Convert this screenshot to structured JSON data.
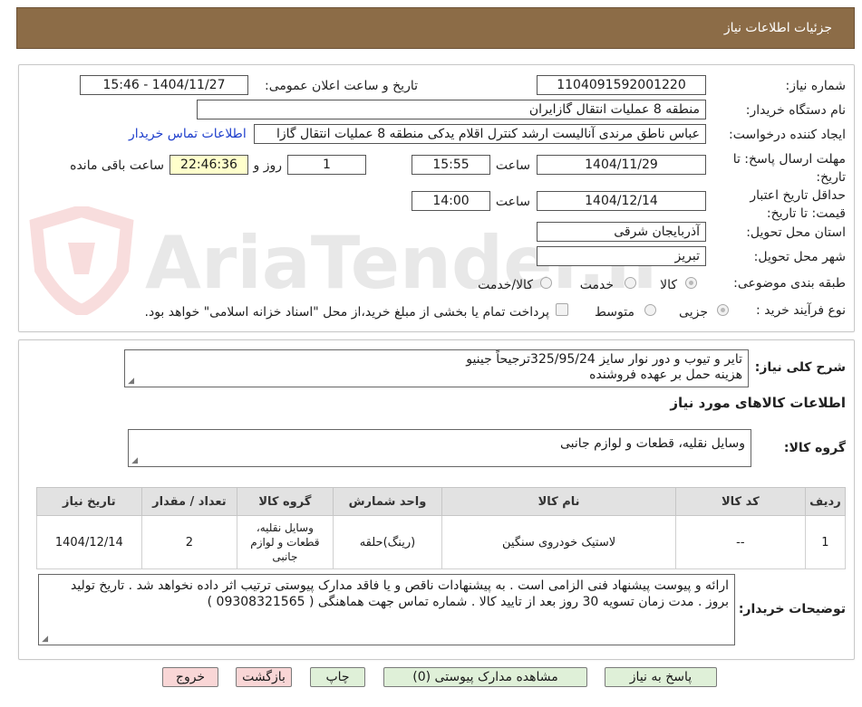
{
  "header": {
    "title": "جزئیات اطلاعات نیاز"
  },
  "watermark": {
    "text": "AriaTender.neT"
  },
  "form": {
    "need_number_label": "شماره نیاز:",
    "need_number": "1104091592001220",
    "announce_label": "تاریخ و ساعت اعلان عمومی:",
    "announce_value": "1404/11/27 - 15:46",
    "buyer_label": "نام دستگاه خریدار:",
    "buyer_value": "منطقه 8 عملیات انتقال گازایران",
    "creator_label": "ایجاد کننده درخواست:",
    "creator_value": "عباس ناطق مرندی آنالیست ارشد کنترل اقلام یدکی منطقه 8 عملیات انتقال گازا",
    "contact_link": "اطلاعات تماس خریدار",
    "deadline_label": "مهلت ارسال پاسخ: تا تاریخ:",
    "deadline_date": "1404/11/29",
    "time_word": "ساعت",
    "deadline_time": "15:55",
    "days_value": "1",
    "days_word": "روز و",
    "remaining_time": "22:46:36",
    "remaining_word": "ساعت باقی مانده",
    "validity_label": "حداقل تاریخ اعتبار قیمت: تا تاریخ:",
    "validity_date": "1404/12/14",
    "validity_time": "14:00",
    "province_label": "استان محل تحویل:",
    "province_value": "آذربایجان شرقی",
    "city_label": "شهر محل تحویل:",
    "city_value": "تبریز",
    "category_label": "طبقه بندی موضوعی:",
    "category_options": [
      "کالا",
      "خدمت",
      "کالا/خدمت"
    ],
    "category_selected": "کالا",
    "process_label": "نوع فرآیند خرید :",
    "process_options": [
      "جزیی",
      "متوسط"
    ],
    "process_selected": "جزیی",
    "payment_note": "پرداخت تمام یا بخشی از مبلغ خرید،از محل \"اسناد خزانه اسلامی\" خواهد بود."
  },
  "summary": {
    "label": "شرح کلی نیاز:",
    "line1": "تایر و تیوب و دور نوار سایز 325/95/24ترجیحاً جینیو",
    "line2": "هزینه حمل بر عهده فروشنده"
  },
  "goods": {
    "section_title": "اطلاعات کالاهای مورد نیاز",
    "group_label": "گروه کالا:",
    "group_value": "وسایل نقلیه، قطعات و لوازم جانبی",
    "columns": [
      "ردیف",
      "کد کالا",
      "نام کالا",
      "واحد شمارش",
      "گروه کالا",
      "تعداد / مقدار",
      "تاریخ نیاز"
    ],
    "rows": [
      [
        "1",
        "--",
        "لاستیک خودروی سنگین",
        "(رینگ)حلقه",
        "وسایل نقلیه، قطعات و لوازم جانبی",
        "2",
        "1404/12/14"
      ]
    ]
  },
  "buyer_notes": {
    "label": "توضیحات خریدار:",
    "text": "ارائه و پیوست پیشنهاد فنی الزامی است . به پیشنهادات ناقص و یا فاقد مدارک پیوستی ترتیب اثر داده نخواهد شد . تاریخ تولید بروز . مدت زمان تسویه 30 روز بعد از تایید کالا . شماره تماس جهت هماهنگی ( 09308321565 )"
  },
  "buttons": {
    "reply": "پاسخ به نیاز",
    "view_docs": "مشاهده مدارک پیوستی (0)",
    "print": "چاپ",
    "back": "بازگشت",
    "exit": "خروج"
  }
}
